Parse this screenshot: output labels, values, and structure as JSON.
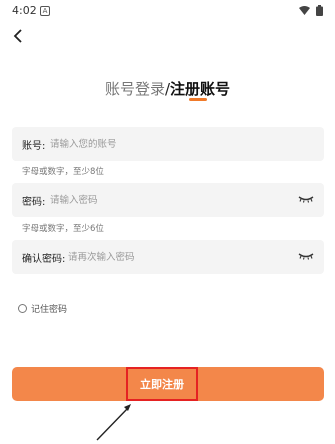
{
  "status_bar": {
    "time": "4:02",
    "badge": "A"
  },
  "tabs": {
    "login": "账号登录",
    "separator": "/",
    "register": "注册账号"
  },
  "fields": {
    "account": {
      "label": "账号:",
      "placeholder": "请输入您的账号",
      "hint": "字母或数字，至少8位"
    },
    "password": {
      "label": "密码:",
      "placeholder": "请输入密码",
      "hint": "字母或数字，至少6位"
    },
    "confirm": {
      "label": "确认密码:",
      "placeholder": "请再次输入密码"
    }
  },
  "remember_label": "记住密码",
  "submit_label": "立即注册",
  "colors": {
    "accent": "#f07a2a",
    "button": "#f3874a",
    "annotation": "#e52222"
  },
  "icons": [
    "back-arrow-icon",
    "wifi-icon",
    "battery-icon",
    "eye-closed-icon"
  ]
}
